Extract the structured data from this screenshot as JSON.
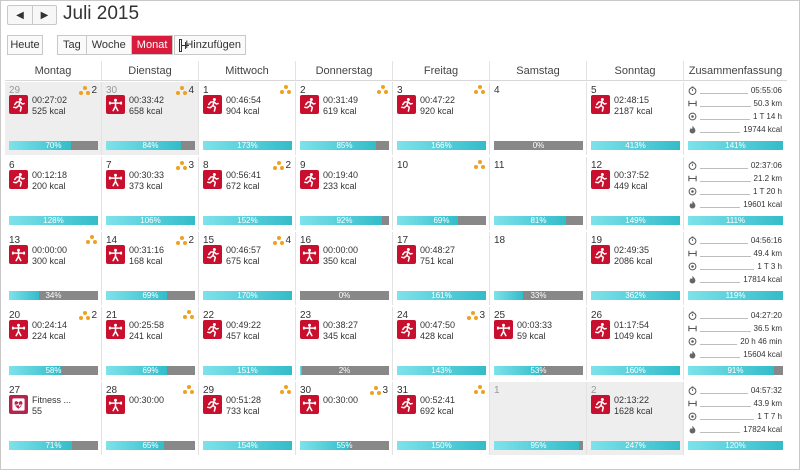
{
  "header": {
    "month": "Juli 2015",
    "prev_label": "◀",
    "next_label": "▶",
    "today_label": "Heute",
    "views": [
      "Tag",
      "Woche",
      "Monat"
    ],
    "active_view": "Monat",
    "add_label": "Hinzufügen"
  },
  "columns": [
    "Montag",
    "Dienstag",
    "Mittwoch",
    "Donnerstag",
    "Freitag",
    "Samstag",
    "Sonntag",
    "Zusammenfassung"
  ],
  "weeks": [
    {
      "days": [
        {
          "day": "29",
          "outside": true,
          "warn": "2",
          "activity": "run",
          "duration": "00:27:02",
          "kcal": "525 kcal",
          "percent": 70,
          "label": "70%"
        },
        {
          "day": "30",
          "outside": true,
          "warn": "4",
          "activity": "gym",
          "duration": "00:33:42",
          "kcal": "658 kcal",
          "percent": 84,
          "label": "84%"
        },
        {
          "day": "1",
          "outside": false,
          "warn": "",
          "activity": "run",
          "duration": "00:46:54",
          "kcal": "904 kcal",
          "percent": 173,
          "label": "173%"
        },
        {
          "day": "2",
          "outside": false,
          "warn": "",
          "activity": "run",
          "duration": "00:31:49",
          "kcal": "619 kcal",
          "percent": 85,
          "label": "85%"
        },
        {
          "day": "3",
          "outside": false,
          "warn": "",
          "activity": "run",
          "duration": "00:47:22",
          "kcal": "920 kcal",
          "percent": 166,
          "label": "166%"
        },
        {
          "day": "4",
          "outside": false,
          "warn": null,
          "activity": null,
          "duration": "",
          "kcal": "",
          "percent": 0,
          "label": "0%"
        },
        {
          "day": "5",
          "outside": false,
          "warn": null,
          "activity": "run",
          "duration": "02:48:15",
          "kcal": "2187 kcal",
          "percent": 413,
          "label": "413%"
        }
      ],
      "summary": {
        "time": "05:55:06",
        "distance": "50.3 km",
        "sleep": "1 T 14 h",
        "kcal": "19744 kcal",
        "percent": 141,
        "label": "141%"
      }
    },
    {
      "days": [
        {
          "day": "6",
          "outside": false,
          "warn": null,
          "activity": "run",
          "duration": "00:12:18",
          "kcal": "200 kcal",
          "percent": 128,
          "label": "128%"
        },
        {
          "day": "7",
          "outside": false,
          "warn": "3",
          "activity": "gym",
          "duration": "00:30:33",
          "kcal": "373 kcal",
          "percent": 106,
          "label": "106%"
        },
        {
          "day": "8",
          "outside": false,
          "warn": "2",
          "activity": "run",
          "duration": "00:56:41",
          "kcal": "672 kcal",
          "percent": 152,
          "label": "152%"
        },
        {
          "day": "9",
          "outside": false,
          "warn": null,
          "activity": "run",
          "duration": "00:19:40",
          "kcal": "233 kcal",
          "percent": 92,
          "label": "92%"
        },
        {
          "day": "10",
          "outside": false,
          "warn": "",
          "activity": null,
          "duration": "",
          "kcal": "",
          "percent": 69,
          "label": "69%"
        },
        {
          "day": "11",
          "outside": false,
          "warn": null,
          "activity": null,
          "duration": "",
          "kcal": "",
          "percent": 81,
          "label": "81%"
        },
        {
          "day": "12",
          "outside": false,
          "warn": null,
          "activity": "run",
          "duration": "00:37:52",
          "kcal": "449 kcal",
          "percent": 149,
          "label": "149%"
        }
      ],
      "summary": {
        "time": "02:37:06",
        "distance": "21.2 km",
        "sleep": "1 T 20 h",
        "kcal": "19601 kcal",
        "percent": 111,
        "label": "111%"
      }
    },
    {
      "days": [
        {
          "day": "13",
          "outside": false,
          "warn": "",
          "activity": "gym",
          "duration": "00:00:00",
          "kcal": "300 kcal",
          "percent": 34,
          "label": "34%"
        },
        {
          "day": "14",
          "outside": false,
          "warn": "2",
          "activity": "gym",
          "duration": "00:31:16",
          "kcal": "168 kcal",
          "percent": 69,
          "label": "69%"
        },
        {
          "day": "15",
          "outside": false,
          "warn": "4",
          "activity": "run",
          "duration": "00:46:57",
          "kcal": "675 kcal",
          "percent": 170,
          "label": "170%"
        },
        {
          "day": "16",
          "outside": false,
          "warn": null,
          "activity": "gym",
          "duration": "00:00:00",
          "kcal": "350 kcal",
          "percent": 0,
          "label": "0%"
        },
        {
          "day": "17",
          "outside": false,
          "warn": null,
          "activity": "run",
          "duration": "00:48:27",
          "kcal": "751 kcal",
          "percent": 161,
          "label": "161%"
        },
        {
          "day": "18",
          "outside": false,
          "warn": null,
          "activity": null,
          "duration": "",
          "kcal": "",
          "percent": 33,
          "label": "33%"
        },
        {
          "day": "19",
          "outside": false,
          "warn": null,
          "activity": "run",
          "duration": "02:49:35",
          "kcal": "2086 kcal",
          "percent": 362,
          "label": "362%"
        }
      ],
      "summary": {
        "time": "04:56:16",
        "distance": "49.4 km",
        "sleep": "1 T 3 h",
        "kcal": "17814 kcal",
        "percent": 119,
        "label": "119%"
      }
    },
    {
      "days": [
        {
          "day": "20",
          "outside": false,
          "warn": "2",
          "activity": "gym",
          "duration": "00:24:14",
          "kcal": "224 kcal",
          "percent": 58,
          "label": "58%"
        },
        {
          "day": "21",
          "outside": false,
          "warn": "",
          "activity": "gym",
          "duration": "00:25:58",
          "kcal": "241 kcal",
          "percent": 69,
          "label": "69%"
        },
        {
          "day": "22",
          "outside": false,
          "warn": null,
          "activity": "run",
          "duration": "00:49:22",
          "kcal": "457 kcal",
          "percent": 151,
          "label": "151%"
        },
        {
          "day": "23",
          "outside": false,
          "warn": null,
          "activity": "gym",
          "duration": "00:38:27",
          "kcal": "345 kcal",
          "percent": 2,
          "label": "2%"
        },
        {
          "day": "24",
          "outside": false,
          "warn": "3",
          "activity": "run",
          "duration": "00:47:50",
          "kcal": "428 kcal",
          "percent": 143,
          "label": "143%"
        },
        {
          "day": "25",
          "outside": false,
          "warn": null,
          "activity": "gym",
          "duration": "00:03:33",
          "kcal": "59 kcal",
          "percent": 53,
          "label": "53%"
        },
        {
          "day": "26",
          "outside": false,
          "warn": null,
          "activity": "run",
          "duration": "01:17:54",
          "kcal": "1049 kcal",
          "percent": 160,
          "label": "160%"
        }
      ],
      "summary": {
        "time": "04:27:20",
        "distance": "36.5 km",
        "sleep": "20 h 46 min",
        "kcal": "15604 kcal",
        "percent": 91,
        "label": "91%"
      }
    },
    {
      "days": [
        {
          "day": "27",
          "outside": false,
          "warn": null,
          "activity": "fitness",
          "duration": "Fitness ...",
          "kcal": "55",
          "percent": 71,
          "label": "71%"
        },
        {
          "day": "28",
          "outside": false,
          "warn": "",
          "activity": "gym",
          "duration": "00:30:00",
          "kcal": "",
          "percent": 65,
          "label": "65%"
        },
        {
          "day": "29",
          "outside": false,
          "warn": "",
          "activity": "run",
          "duration": "00:51:28",
          "kcal": "733 kcal",
          "percent": 154,
          "label": "154%"
        },
        {
          "day": "30",
          "outside": false,
          "warn": "3",
          "activity": "gym",
          "duration": "00:30:00",
          "kcal": "",
          "percent": 55,
          "label": "55%"
        },
        {
          "day": "31",
          "outside": false,
          "warn": "",
          "activity": "run",
          "duration": "00:52:41",
          "kcal": "692 kcal",
          "percent": 150,
          "label": "150%"
        },
        {
          "day": "1",
          "outside": true,
          "warn": null,
          "activity": null,
          "duration": "",
          "kcal": "",
          "percent": 95,
          "label": "95%"
        },
        {
          "day": "2",
          "outside": true,
          "warn": null,
          "activity": "run",
          "duration": "02:13:22",
          "kcal": "1628 kcal",
          "percent": 247,
          "label": "247%"
        }
      ],
      "summary": {
        "time": "04:57:32",
        "distance": "43.9 km",
        "sleep": "1 T 7 h",
        "kcal": "17824 kcal",
        "percent": 120,
        "label": "120%"
      }
    }
  ],
  "icons": {
    "run": "running-person-icon",
    "gym": "weightlifting-icon",
    "fitness": "fitness-heart-icon",
    "warn": "warning-dots-icon",
    "time": "stopwatch-icon",
    "distance": "distance-icon",
    "sleep": "sleep-icon",
    "kcal": "flame-icon"
  },
  "colors": {
    "accent": "#d91b3c",
    "activity_tile": "#c8102e",
    "progress_fill": "#33bcc9",
    "progress_track": "#888888",
    "warning": "#f0a020",
    "outside_month_bg": "#eeeeee"
  }
}
